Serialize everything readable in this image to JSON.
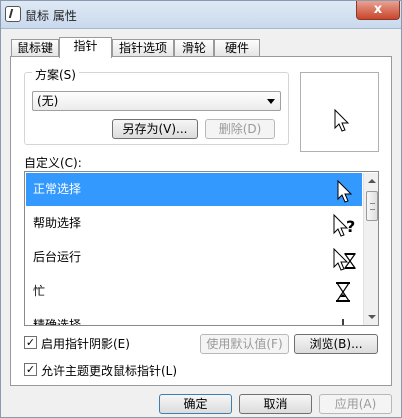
{
  "window": {
    "title": "鼠标 属性",
    "close_glyph": "x"
  },
  "tabs": [
    {
      "label": "鼠标键",
      "active": false
    },
    {
      "label": "指针",
      "active": true
    },
    {
      "label": "指针选项",
      "active": false
    },
    {
      "label": "滑轮",
      "active": false
    },
    {
      "label": "硬件",
      "active": false
    }
  ],
  "scheme": {
    "legend": "方案(S)",
    "selected": "(无)",
    "save_as_label": "另存为(V)...",
    "delete_label": "删除(D)"
  },
  "customize": {
    "label": "自定义(C):",
    "items": [
      {
        "label": "正常选择",
        "cursor": "arrow-cursor",
        "selected": true
      },
      {
        "label": "帮助选择",
        "cursor": "help-cursor",
        "selected": false
      },
      {
        "label": "后台运行",
        "cursor": "working-in-background-cursor",
        "selected": false
      },
      {
        "label": "忙",
        "cursor": "busy-cursor",
        "selected": false
      },
      {
        "label": "精确选择",
        "cursor": "precision-cursor",
        "selected": false
      }
    ]
  },
  "options": {
    "shadow_label": "启用指针阴影(E)",
    "shadow_checked": true,
    "use_default_label": "使用默认值(F)",
    "browse_label": "浏览(B)...",
    "allow_theme_label": "允许主题更改鼠标指针(L)",
    "allow_theme_checked": true
  },
  "footer": {
    "ok_label": "确定",
    "cancel_label": "取消",
    "apply_label": "应用(A)"
  },
  "colors": {
    "selection": "#3399ff",
    "window_bg": "#f0f0f0",
    "close_button": "#c8452c"
  }
}
